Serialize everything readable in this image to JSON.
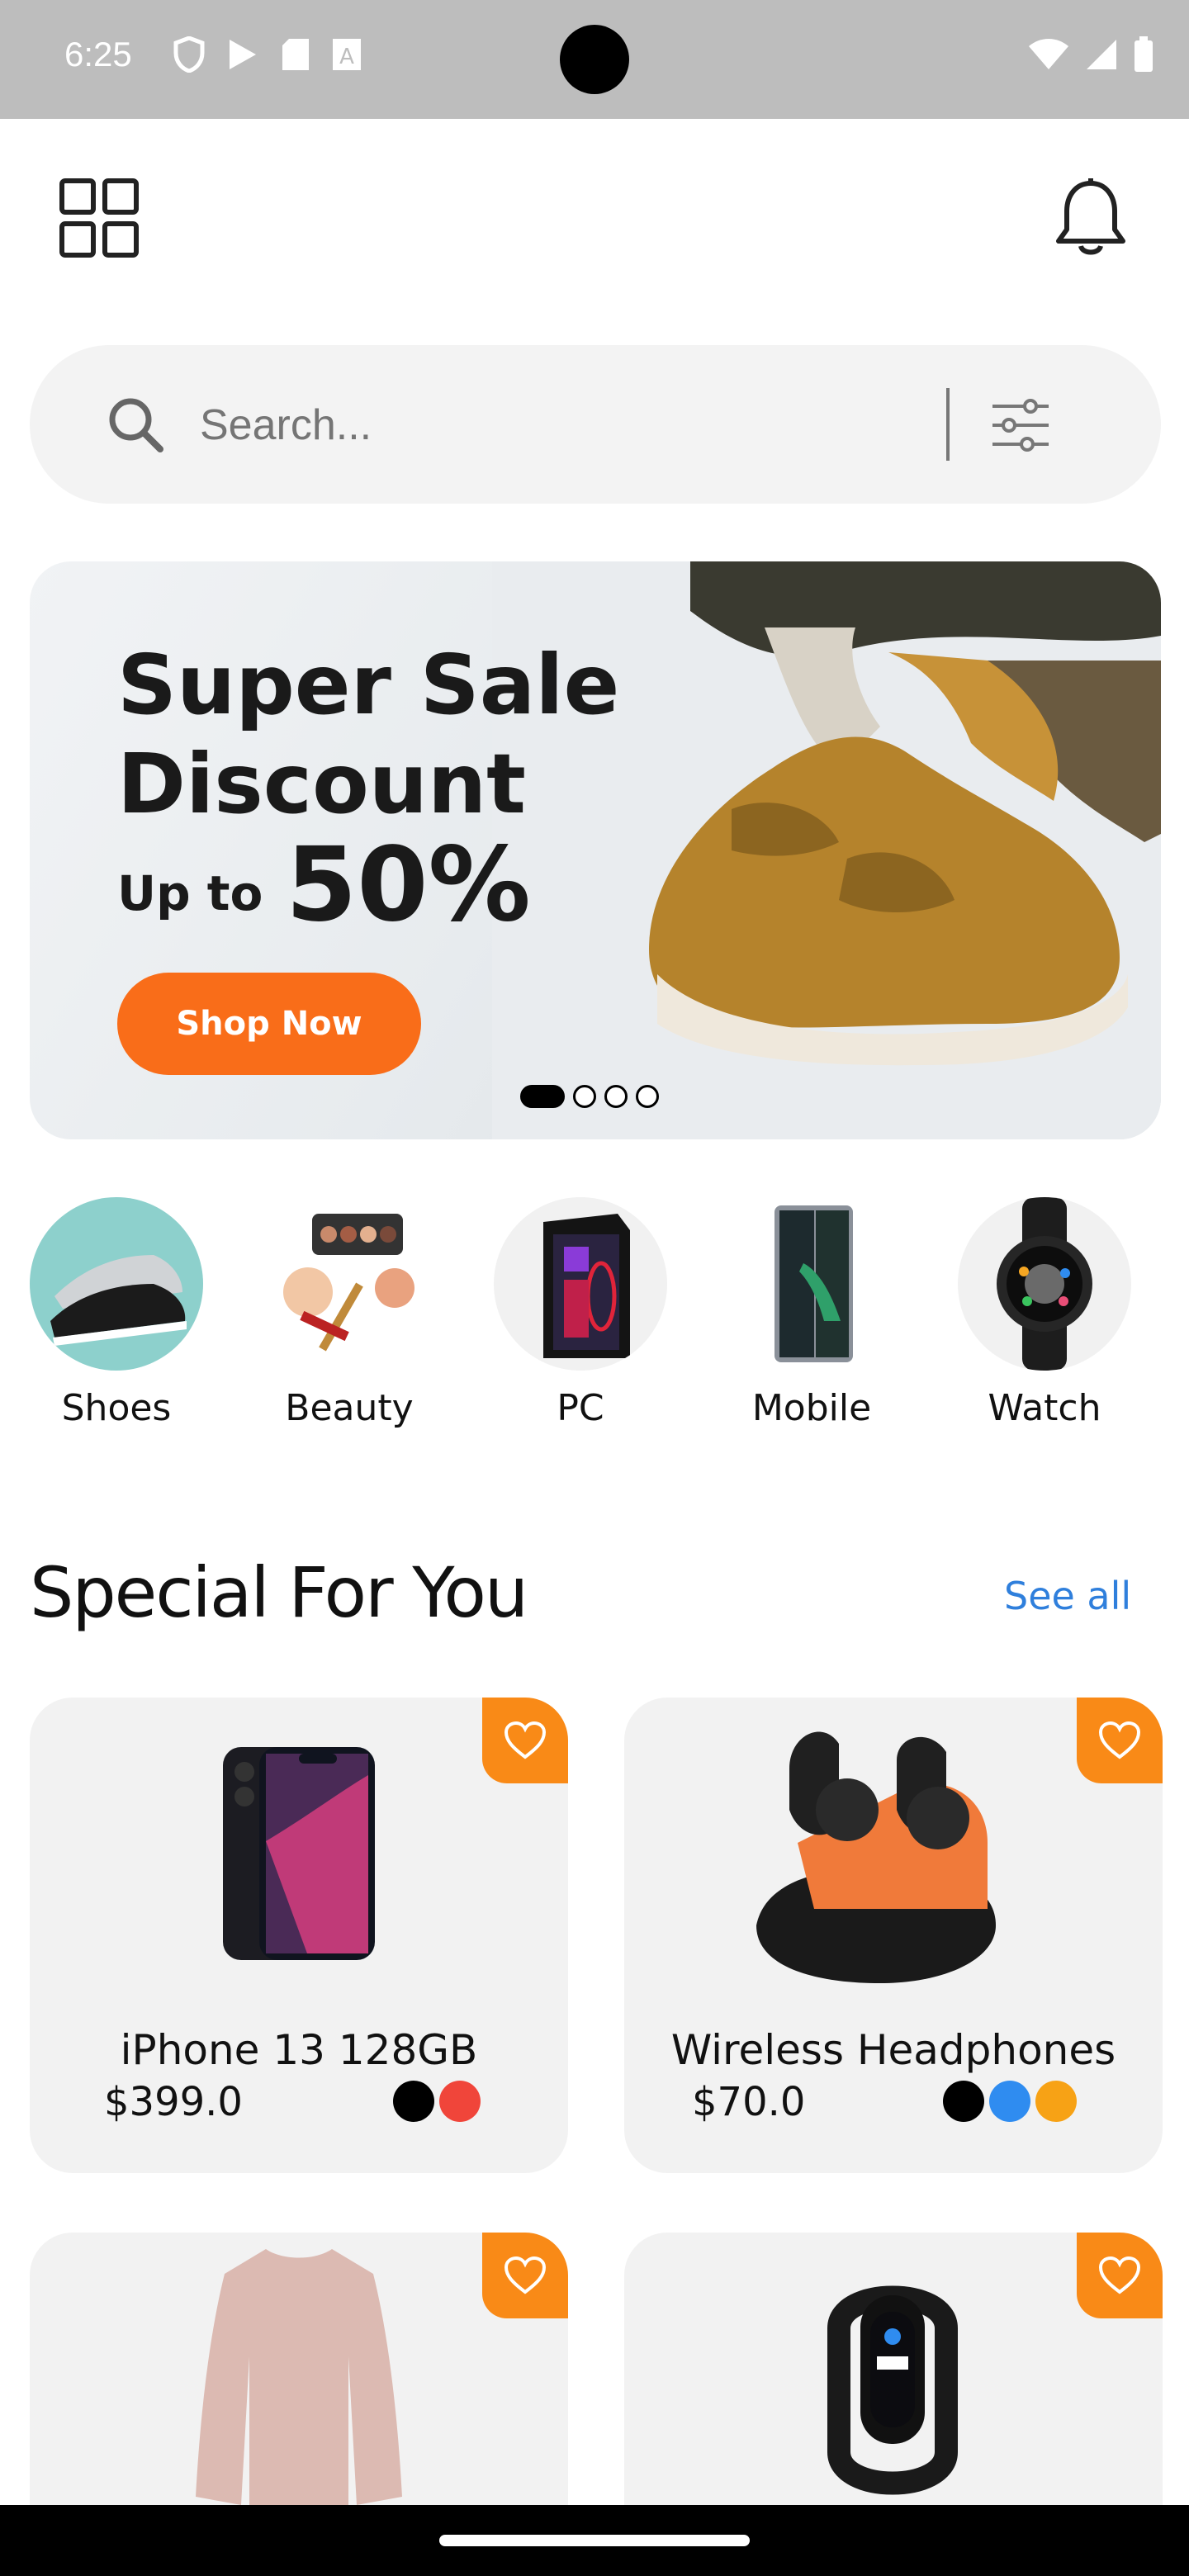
{
  "status_bar": {
    "time": "6:25"
  },
  "search": {
    "placeholder": "Search..."
  },
  "banner": {
    "title_line1": "Super Sale",
    "title_line2": "Discount",
    "upto": "Up to",
    "percent": "50%",
    "cta": "Shop Now",
    "slide_count": 4,
    "active_slide": 1
  },
  "categories": [
    {
      "label": "Shoes",
      "icon": "shoes-image"
    },
    {
      "label": "Beauty",
      "icon": "makeup-image"
    },
    {
      "label": "PC",
      "icon": "pc-tower-image"
    },
    {
      "label": "Mobile",
      "icon": "foldable-phone-image"
    },
    {
      "label": "Watch",
      "icon": "smartwatch-image"
    }
  ],
  "special": {
    "title": "Special For You",
    "see_all": "See all"
  },
  "products": [
    {
      "name": "iPhone 13 128GB",
      "price": "$399.0",
      "colors": [
        "#000000",
        "#f0453a"
      ]
    },
    {
      "name": "Wireless Headphones",
      "price": "$70.0",
      "colors": [
        "#000000",
        "#2f8cf0",
        "#f7a215"
      ]
    },
    {
      "name": "",
      "price": "",
      "colors": [],
      "image": "sweater-image"
    },
    {
      "name": "",
      "price": "",
      "colors": [],
      "image": "fitness-band-image"
    }
  ],
  "colors": {
    "accent": "#f96d19",
    "favorite_bg": "#f98a17",
    "link": "#2f7fdc"
  }
}
